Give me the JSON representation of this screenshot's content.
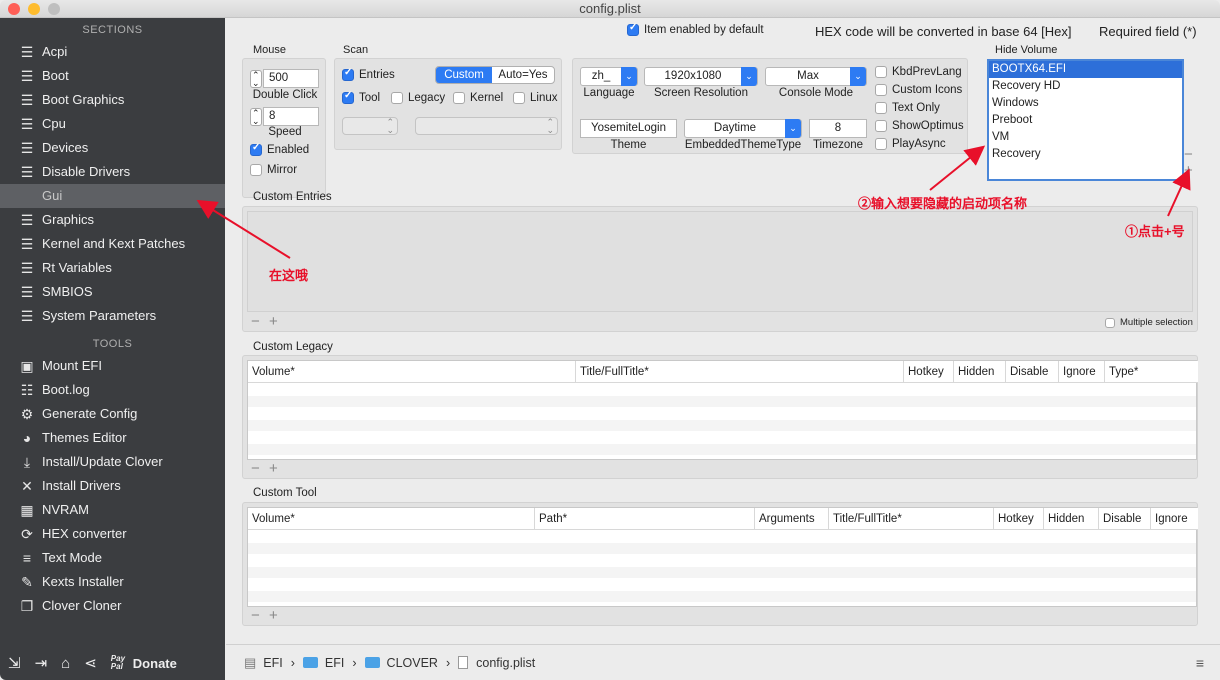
{
  "window": {
    "title": "config.plist"
  },
  "sidebar": {
    "sections_header": "SECTIONS",
    "tools_header": "TOOLS",
    "sections": [
      {
        "label": "Acpi",
        "icon": "list-icon"
      },
      {
        "label": "Boot",
        "icon": "list-icon"
      },
      {
        "label": "Boot Graphics",
        "icon": "list-icon"
      },
      {
        "label": "Cpu",
        "icon": "list-icon"
      },
      {
        "label": "Devices",
        "icon": "list-icon"
      },
      {
        "label": "Disable Drivers",
        "icon": "list-icon"
      },
      {
        "label": "Gui",
        "icon": "list-icon"
      },
      {
        "label": "Graphics",
        "icon": "list-icon"
      },
      {
        "label": "Kernel and Kext Patches",
        "icon": "list-icon"
      },
      {
        "label": "Rt Variables",
        "icon": "list-icon"
      },
      {
        "label": "SMBIOS",
        "icon": "list-icon"
      },
      {
        "label": "System Parameters",
        "icon": "list-icon"
      }
    ],
    "tools": [
      {
        "label": "Mount EFI",
        "icon": "disk-icon"
      },
      {
        "label": "Boot.log",
        "icon": "log-icon"
      },
      {
        "label": "Generate Config",
        "icon": "gears-icon"
      },
      {
        "label": "Themes Editor",
        "icon": "palette-icon"
      },
      {
        "label": "Install/Update Clover",
        "icon": "download-icon"
      },
      {
        "label": "Install Drivers",
        "icon": "tools-icon"
      },
      {
        "label": "NVRAM",
        "icon": "chip-icon"
      },
      {
        "label": "HEX converter",
        "icon": "convert-icon"
      },
      {
        "label": "Text Mode",
        "icon": "text-icon"
      },
      {
        "label": "Kexts Installer",
        "icon": "plug-icon"
      },
      {
        "label": "Clover Cloner",
        "icon": "clone-icon"
      }
    ],
    "donate": "Donate",
    "paypal": "Pay Pal"
  },
  "header": {
    "item_enabled": "Item enabled by default",
    "hex_note": "HEX code will be converted in base 64 [Hex]",
    "required": "Required field (*)"
  },
  "mouse": {
    "title": "Mouse",
    "speed_value": "500",
    "double_click_label": "Double Click",
    "double_value": "8",
    "speed_label": "Speed",
    "enabled_label": "Enabled",
    "mirror_label": "Mirror"
  },
  "scan": {
    "title": "Scan",
    "entries": "Entries",
    "tool": "Tool",
    "legacy": "Legacy",
    "kernel": "Kernel",
    "linux": "Linux",
    "seg_custom": "Custom",
    "seg_auto": "Auto=Yes"
  },
  "gui_opts": {
    "language_value": "zh_",
    "language_label": "Language",
    "resolution_value": "1920x1080",
    "resolution_label": "Screen Resolution",
    "console_value": "Max",
    "console_label": "Console Mode",
    "theme_value": "YosemiteLogin",
    "theme_label": "Theme",
    "embedded_value": "Daytime",
    "embedded_label": "EmbeddedThemeType",
    "timezone_value": "8",
    "timezone_label": "Timezone",
    "checks": [
      "KbdPrevLang",
      "Custom Icons",
      "Text Only",
      "ShowOptimus",
      "PlayAsync"
    ]
  },
  "hide_volume": {
    "title": "Hide Volume",
    "items": [
      "BOOTX64.EFI",
      "Recovery HD",
      "Windows",
      "Preboot",
      "VM",
      "Recovery"
    ]
  },
  "custom_entries": {
    "title": "Custom Entries",
    "multiple": "Multiple selection"
  },
  "custom_legacy": {
    "title": "Custom Legacy",
    "columns": [
      "Volume*",
      "Title/FullTitle*",
      "Hotkey",
      "Hidden",
      "Disable",
      "Ignore",
      "Type*"
    ]
  },
  "custom_tool": {
    "title": "Custom Tool",
    "columns": [
      "Volume*",
      "Path*",
      "Arguments",
      "Title/FullTitle*",
      "Hotkey",
      "Hidden",
      "Disable",
      "Ignore"
    ]
  },
  "annotations": {
    "here": "在这哦",
    "step2": "②输入想要隐藏的启动项名称",
    "step1": "①点击+号"
  },
  "footer": {
    "path": [
      "EFI",
      "EFI",
      "CLOVER",
      "config.plist"
    ]
  },
  "colors": {
    "accent": "#2d7bf3",
    "annotation": "#e8102a",
    "sidebar": "#3b3d40"
  }
}
